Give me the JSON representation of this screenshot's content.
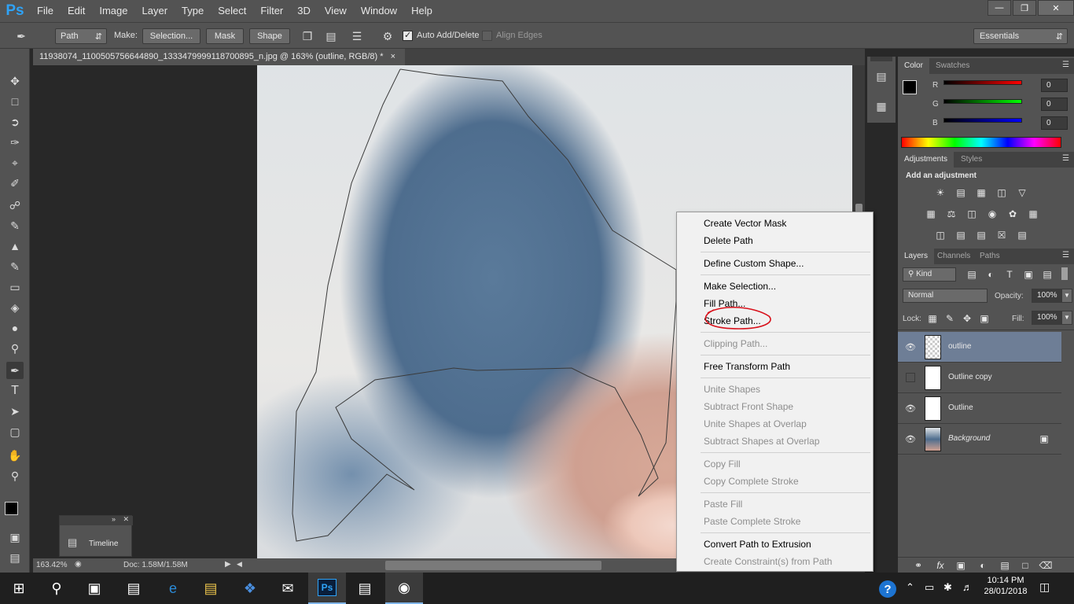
{
  "app": {
    "logo_text": "Ps"
  },
  "menu": [
    "File",
    "Edit",
    "Image",
    "Layer",
    "Type",
    "Select",
    "Filter",
    "3D",
    "View",
    "Window",
    "Help"
  ],
  "options_bar": {
    "tool_mode": "Path",
    "make_label": "Make:",
    "selection_btn": "Selection...",
    "mask_btn": "Mask",
    "shape_btn": "Shape",
    "auto_add_delete": "Auto Add/Delete",
    "align_edges": "Align Edges",
    "workspace": "Essentials"
  },
  "document_tab": {
    "title": "11938074_1100505756644890_1333479999118700895_n.jpg @ 163% (outline, RGB/8) *",
    "close": "×"
  },
  "status_bar": {
    "zoom": "163.42%",
    "doc": "Doc: 1.58M/1.58M"
  },
  "timeline": {
    "label": "Timeline"
  },
  "context_menu": {
    "items": [
      {
        "label": "Create Vector Mask",
        "disabled": false
      },
      {
        "label": "Delete Path",
        "disabled": false
      },
      {
        "label": "Define Custom Shape...",
        "disabled": false
      },
      {
        "label": "Make Selection...",
        "disabled": false
      },
      {
        "label": "Fill Path...",
        "disabled": false
      },
      {
        "label": "Stroke Path...",
        "disabled": false
      },
      {
        "label": "Clipping Path...",
        "disabled": true
      },
      {
        "label": "Free Transform Path",
        "disabled": false
      },
      {
        "label": "Unite Shapes",
        "disabled": true
      },
      {
        "label": "Subtract Front Shape",
        "disabled": true
      },
      {
        "label": "Unite Shapes at Overlap",
        "disabled": true
      },
      {
        "label": "Subtract Shapes at Overlap",
        "disabled": true
      },
      {
        "label": "Copy Fill",
        "disabled": true
      },
      {
        "label": "Copy Complete Stroke",
        "disabled": true
      },
      {
        "label": "Paste Fill",
        "disabled": true
      },
      {
        "label": "Paste Complete Stroke",
        "disabled": true
      },
      {
        "label": "Convert Path to Extrusion",
        "disabled": false
      },
      {
        "label": "Create Constraint(s) from Path",
        "disabled": true
      }
    ]
  },
  "color_panel": {
    "tabs": [
      "Color",
      "Swatches"
    ],
    "channels": [
      {
        "name": "R",
        "value": "0"
      },
      {
        "name": "G",
        "value": "0"
      },
      {
        "name": "B",
        "value": "0"
      }
    ]
  },
  "adjustments_panel": {
    "tabs": [
      "Adjustments",
      "Styles"
    ],
    "heading": "Add an adjustment"
  },
  "layers_panel": {
    "tabs": [
      "Layers",
      "Channels",
      "Paths"
    ],
    "filter_kind": "Kind",
    "blend_mode": "Normal",
    "opacity_label": "Opacity:",
    "opacity_value": "100%",
    "lock_label": "Lock:",
    "fill_label": "Fill:",
    "fill_value": "100%",
    "layers": [
      {
        "name": "outline",
        "visible": true,
        "selected": true
      },
      {
        "name": "Outline copy",
        "visible": false,
        "selected": false
      },
      {
        "name": "Outline",
        "visible": true,
        "selected": false
      },
      {
        "name": "Background",
        "visible": true,
        "selected": false,
        "locked": true
      }
    ]
  },
  "taskbar": {
    "time": "10:14 PM",
    "date": "28/01/2018",
    "help_badge": "?"
  },
  "colors": {
    "panel_bg": "#535353",
    "dark_bg": "#282828",
    "selected_layer": "#6e7e96",
    "annotation_red": "#d8101a"
  }
}
